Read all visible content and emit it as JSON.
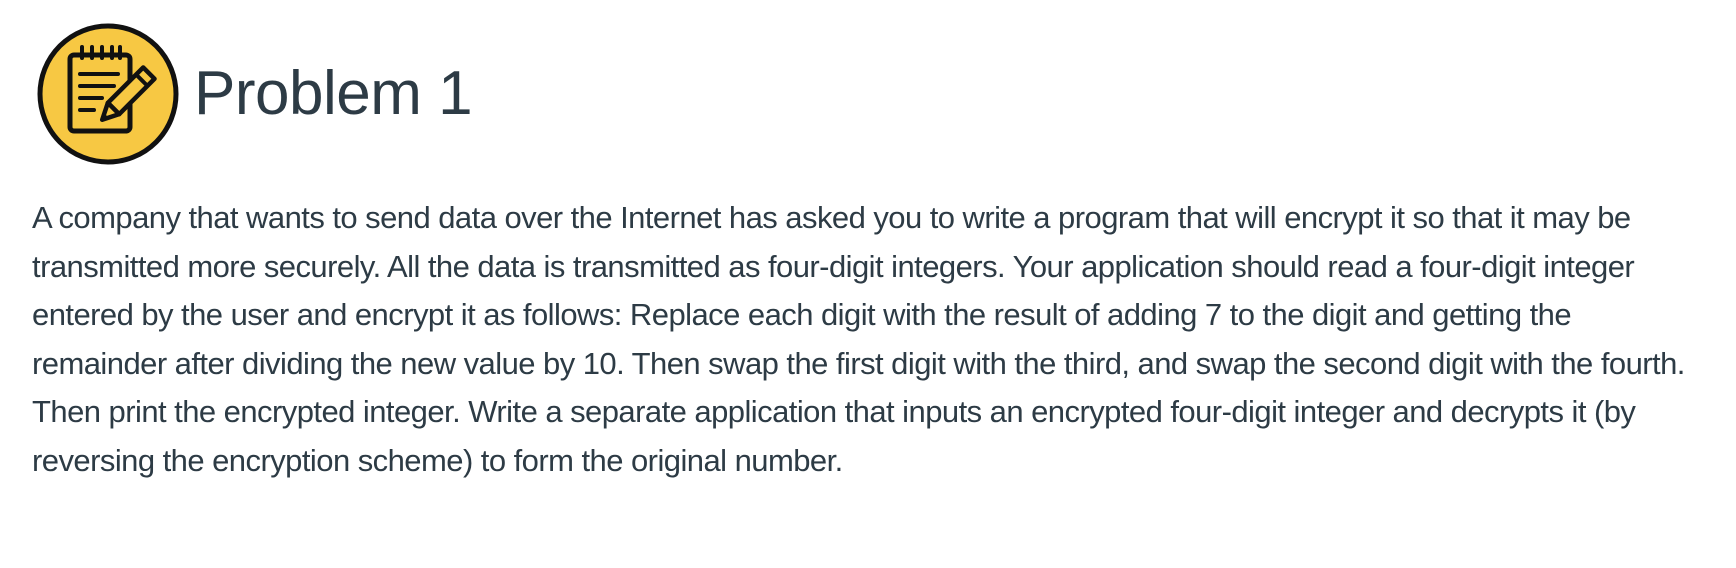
{
  "header": {
    "icon": "notepad-pencil-icon",
    "icon_colors": {
      "fill": "#f7c843",
      "outline": "#111111"
    },
    "title": "Problem 1"
  },
  "content": {
    "paragraph": "A company that wants to send data over the Internet has asked you to write a program that will encrypt it so that it may be transmitted more securely. All the data is transmitted as four-digit integers. Your application should read a four-digit integer entered by the user and encrypt it as follows: Replace each digit with the result of adding 7 to the digit and getting the remainder after dividing the new value by 10. Then swap the first digit with the third, and swap the second digit with the fourth. Then print the encrypted integer. Write a separate application that inputs an encrypted four-digit integer and decrypts it (by reversing the encryption scheme) to form the original number."
  }
}
